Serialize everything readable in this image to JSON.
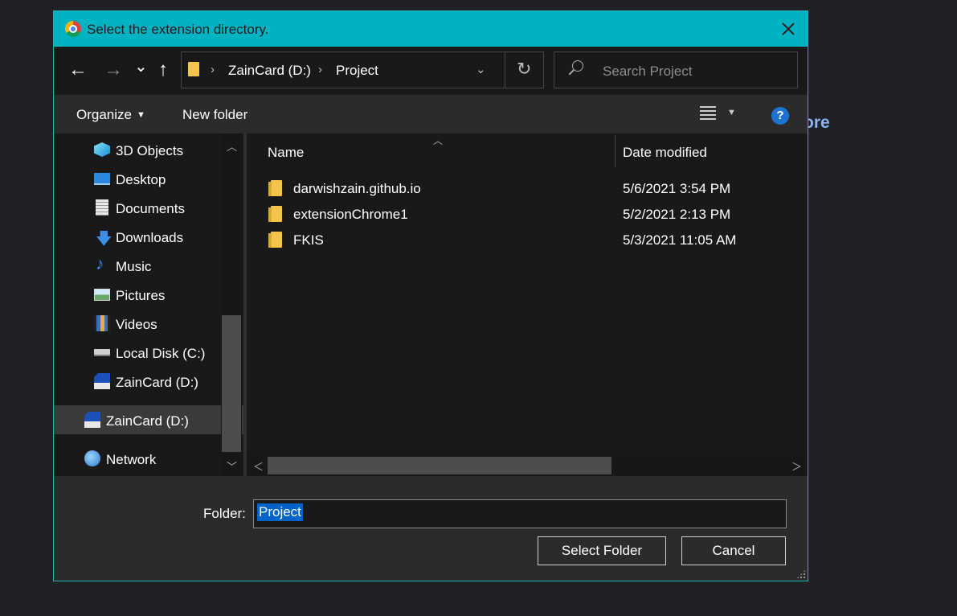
{
  "background": {
    "partial_text": "ore",
    "accent": "#8ab4f8"
  },
  "dialog": {
    "title": "Select the extension directory.",
    "title_bar_color": "#00b3c3"
  },
  "nav": {
    "back_icon": "←",
    "forward_icon": "→",
    "recent_icon": "⌄",
    "up_icon": "↑"
  },
  "address": {
    "segments": [
      "ZainCard (D:)",
      "Project"
    ],
    "separator": "›",
    "dropdown_icon": "⌄",
    "refresh_icon": "↻"
  },
  "search": {
    "placeholder": "Search Project"
  },
  "toolbar": {
    "organize_label": "Organize",
    "new_folder_label": "New folder",
    "help_label": "?"
  },
  "sidebar": {
    "items": [
      {
        "label": "3D Objects",
        "icon": "cube-icon"
      },
      {
        "label": "Desktop",
        "icon": "desktop-icon"
      },
      {
        "label": "Documents",
        "icon": "document-icon"
      },
      {
        "label": "Downloads",
        "icon": "download-icon"
      },
      {
        "label": "Music",
        "icon": "music-icon"
      },
      {
        "label": "Pictures",
        "icon": "picture-icon"
      },
      {
        "label": "Videos",
        "icon": "video-icon"
      },
      {
        "label": "Local Disk (C:)",
        "icon": "drive-icon"
      },
      {
        "label": "ZainCard (D:)",
        "icon": "sd-card-icon"
      },
      {
        "label": "ZainCard (D:)",
        "icon": "sd-card-icon",
        "selected": true
      },
      {
        "label": "Network",
        "icon": "network-icon"
      }
    ]
  },
  "files": {
    "columns": {
      "name": "Name",
      "date": "Date modified"
    },
    "rows": [
      {
        "name": "darwishzain.github.io",
        "date": "5/6/2021 3:54 PM"
      },
      {
        "name": "extensionChrome1",
        "date": "5/2/2021 2:13 PM"
      },
      {
        "name": "FKIS",
        "date": "5/3/2021 11:05 AM"
      }
    ]
  },
  "footer": {
    "folder_label": "Folder:",
    "folder_value": "Project",
    "select_label": "Select Folder",
    "cancel_label": "Cancel"
  }
}
